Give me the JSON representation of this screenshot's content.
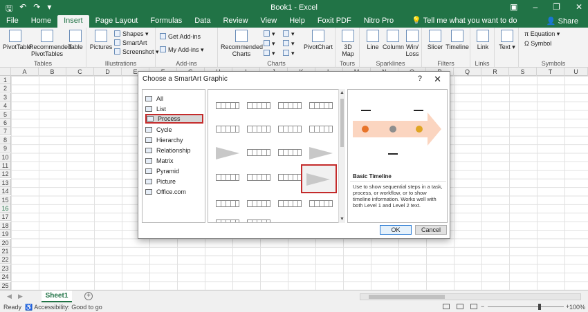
{
  "titlebar": {
    "title": "Book1 - Excel"
  },
  "tabs": [
    "File",
    "Home",
    "Insert",
    "Page Layout",
    "Formulas",
    "Data",
    "Review",
    "View",
    "Help",
    "Foxit PDF",
    "Nitro Pro"
  ],
  "tell_me": "Tell me what you want to do",
  "share": "Share",
  "ribbon": {
    "pivottable": "PivotTable",
    "recommended_pivottables": "Recommended PivotTables",
    "table": "Table",
    "tables_group": "Tables",
    "pictures": "Pictures",
    "shapes": "Shapes",
    "smartart": "SmartArt",
    "screenshot": "Screenshot",
    "illustrations_group": "Illustrations",
    "get_addins": "Get Add-ins",
    "my_addins": "My Add-ins",
    "addins_group": "Add-ins",
    "recommended_charts": "Recommended Charts",
    "charts_group": "Charts",
    "pivotchart": "PivotChart",
    "map_3d": "3D Map",
    "tours_group": "Tours",
    "line": "Line",
    "column": "Column",
    "winloss": "Win/ Loss",
    "sparklines_group": "Sparklines",
    "slicer": "Slicer",
    "timeline": "Timeline",
    "filters_group": "Filters",
    "link": "Link",
    "links_group": "Links",
    "text": "Text",
    "equation": "Equation",
    "symbol": "Symbol",
    "symbols_group": "Symbols"
  },
  "columns": [
    "A",
    "B",
    "C",
    "D",
    "E",
    "F",
    "G",
    "H",
    "I",
    "J",
    "K",
    "L",
    "M",
    "N",
    "O",
    "P",
    "Q",
    "R",
    "S",
    "T",
    "U"
  ],
  "rows": [
    "1",
    "2",
    "3",
    "4",
    "5",
    "6",
    "7",
    "8",
    "9",
    "10",
    "11",
    "12",
    "13",
    "14",
    "15",
    "16",
    "17",
    "18",
    "19",
    "20",
    "21",
    "22",
    "23",
    "24",
    "25"
  ],
  "sheet": {
    "tab": "Sheet1",
    "add": "+"
  },
  "status": {
    "ready": "Ready",
    "accessibility": "Accessibility: Good to go",
    "zoom": "100%",
    "zoom_minus": "−",
    "zoom_plus": "+"
  },
  "dialog": {
    "title": "Choose a SmartArt Graphic",
    "help": "?",
    "close": "✕",
    "categories": [
      "All",
      "List",
      "Process",
      "Cycle",
      "Hierarchy",
      "Relationship",
      "Matrix",
      "Pyramid",
      "Picture",
      "Office.com"
    ],
    "selected_category": "Process",
    "selected_layout": "Basic Timeline",
    "description": "Use to show sequential steps in a task, process, or workflow, or to show timeline information. Works well with both Level 1 and Level 2 text.",
    "ok": "OK",
    "cancel": "Cancel",
    "preview_colors": {
      "arrow": "#fbd5c0",
      "dot1": "#e8742a",
      "dot2": "#8e8e8e",
      "dot3": "#e0a523"
    }
  }
}
